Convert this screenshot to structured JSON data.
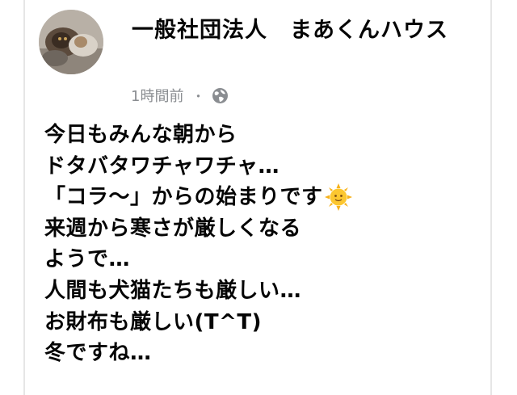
{
  "post": {
    "page_name": "一般社団法人　まあくんハウス",
    "timestamp": "1時間前",
    "separator": "・",
    "privacy_icon": "globe-icon",
    "lines": [
      "今日もみんな朝から",
      "ドタバタワチャワチャ…",
      "「コラ〜」からの始まりです",
      "来週から寒さが厳しくなる",
      "ようで…",
      "人間も犬猫たちも厳しい…",
      "お財布も厳しい(T^T)",
      "冬ですね…"
    ],
    "emoji_icon": "sun-with-face-icon"
  },
  "colors": {
    "text": "#050505",
    "meta": "#8a8d91",
    "border": "#e6e6e6",
    "sun": "#f7b21b"
  }
}
